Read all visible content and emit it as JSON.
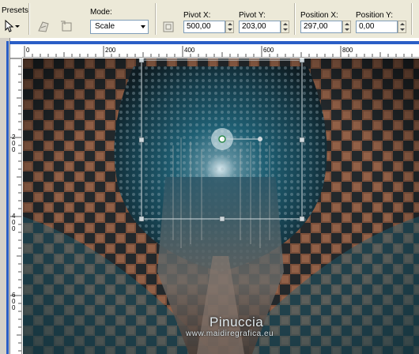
{
  "toolbar": {
    "presets_label": "Presets:",
    "mode_label": "Mode:",
    "mode_value": "Scale",
    "pivot_x_label": "Pivot X:",
    "pivot_x_value": "500,00",
    "pivot_y_label": "Pivot Y:",
    "pivot_y_value": "203,00",
    "position_x_label": "Position X:",
    "position_x_value": "297,00",
    "position_y_label": "Position Y:",
    "position_y_value": "0,00"
  },
  "ruler": {
    "h_ticks": [
      "0",
      "200",
      "400",
      "600",
      "800"
    ],
    "v_ticks": [
      "2\n0\n0",
      "4\n0\n0",
      "6\n0\n0"
    ]
  },
  "watermark": {
    "title": "Pinuccia",
    "url": "www.maidiregrafica.eu"
  },
  "colors": {
    "accent": "#2a5ec6",
    "teal": "#1f5f73",
    "brown": "#6b4534"
  }
}
